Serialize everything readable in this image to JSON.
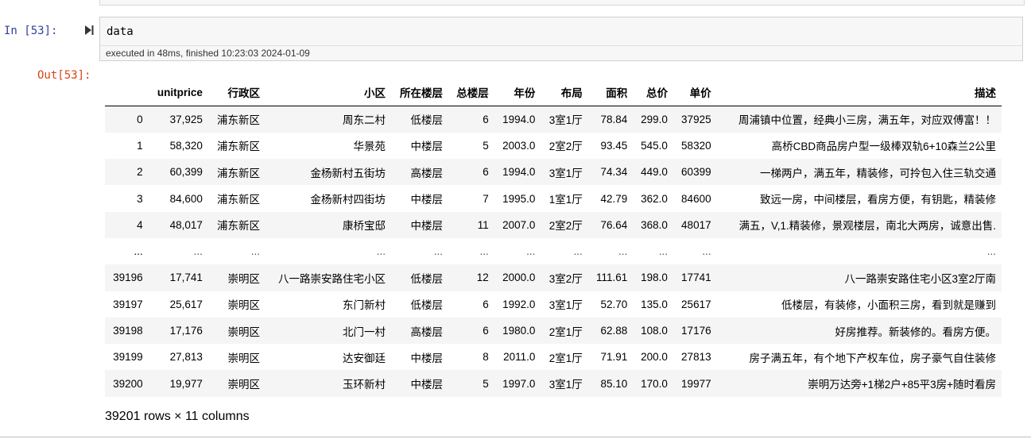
{
  "cell": {
    "in_prompt": "In  [53]:",
    "code": "data",
    "exec_info": "executed in 48ms, finished 10:23:03 2024-01-09",
    "out_prompt": "Out[53]:",
    "run_icon": "run-cell-icon"
  },
  "dataframe": {
    "columns": [
      "",
      "unitprice",
      "行政区",
      "小区",
      "所在楼层",
      "总楼层",
      "年份",
      "布局",
      "面积",
      "总价",
      "单价",
      "描述"
    ],
    "rows": [
      [
        "0",
        "37,925",
        "浦东新区",
        "周东二村",
        "低楼层",
        "6",
        "1994.0",
        "3室1厅",
        "78.84",
        "299.0",
        "37925",
        "周浦镇中位置，经典小三房，满五年，对应双傅富！！"
      ],
      [
        "1",
        "58,320",
        "浦东新区",
        "华景苑",
        "中楼层",
        "5",
        "2003.0",
        "2室2厅",
        "93.45",
        "545.0",
        "58320",
        "高桥CBD商品房户型一级棒双轨6+10森兰2公里"
      ],
      [
        "2",
        "60,399",
        "浦东新区",
        "金杨新村五街坊",
        "高楼层",
        "6",
        "1994.0",
        "3室1厅",
        "74.34",
        "449.0",
        "60399",
        "一梯两户，满五年，精装修，可拎包入住三轨交通"
      ],
      [
        "3",
        "84,600",
        "浦东新区",
        "金杨新村四街坊",
        "中楼层",
        "7",
        "1995.0",
        "1室1厅",
        "42.79",
        "362.0",
        "84600",
        "致远一房，中间楼层，看房方便，有钥匙，精装修"
      ],
      [
        "4",
        "48,017",
        "浦东新区",
        "康桥宝邸",
        "中楼层",
        "11",
        "2007.0",
        "2室2厅",
        "76.64",
        "368.0",
        "48017",
        "满五，V,1.精装修，景观楼层，南北大两房，诚意出售."
      ],
      [
        "...",
        "...",
        "...",
        "...",
        "...",
        "...",
        "...",
        "...",
        "...",
        "...",
        "...",
        "..."
      ],
      [
        "39196",
        "17,741",
        "崇明区",
        "八一路崇安路住宅小区",
        "低楼层",
        "12",
        "2000.0",
        "3室2厅",
        "111.61",
        "198.0",
        "17741",
        "八一路崇安路住宅小区3室2厅南"
      ],
      [
        "39197",
        "25,617",
        "崇明区",
        "东门新村",
        "低楼层",
        "6",
        "1992.0",
        "3室1厅",
        "52.70",
        "135.0",
        "25617",
        "低楼层，有装修，小面积三房，看到就是赚到"
      ],
      [
        "39198",
        "17,176",
        "崇明区",
        "北门一村",
        "高楼层",
        "6",
        "1980.0",
        "2室1厅",
        "62.88",
        "108.0",
        "17176",
        "好房推荐。新装修的。看房方便。"
      ],
      [
        "39199",
        "27,813",
        "崇明区",
        "达安御廷",
        "中楼层",
        "8",
        "2011.0",
        "2室1厅",
        "71.91",
        "200.0",
        "27813",
        "房子满五年，有个地下产权车位，房子豪气自住装修"
      ],
      [
        "39200",
        "19,977",
        "崇明区",
        "玉环新村",
        "中楼层",
        "5",
        "1997.0",
        "3室1厅",
        "85.10",
        "170.0",
        "19977",
        "崇明万达旁+1梯2户+85平3房+随时看房"
      ]
    ],
    "shape_text": "39201 rows × 11 columns"
  }
}
